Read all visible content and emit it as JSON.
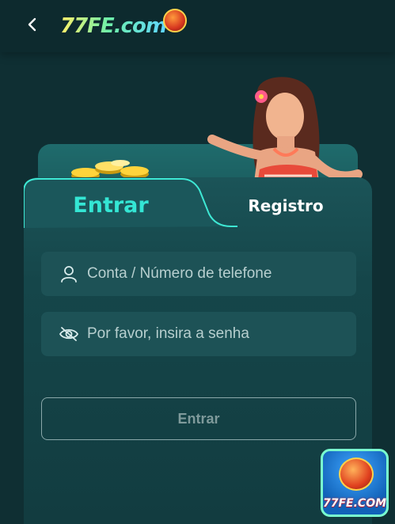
{
  "header": {
    "back_icon": "chevron-left-icon",
    "logo_text": "77FE.com"
  },
  "tabs": {
    "login_label": "Entrar",
    "register_label": "Registro",
    "active": "Entrar"
  },
  "form": {
    "account_icon": "user-icon",
    "account_placeholder": "Conta / Número de telefone",
    "account_value": "",
    "password_icon": "eye-off-icon",
    "password_placeholder": "Por favor, insira a senha",
    "password_value": "",
    "submit_label": "Entrar"
  },
  "badge": {
    "text": "77FE.COM"
  },
  "colors": {
    "background": "#0f2f33",
    "accent": "#34e6d4",
    "field_bg": "#1d5256"
  }
}
